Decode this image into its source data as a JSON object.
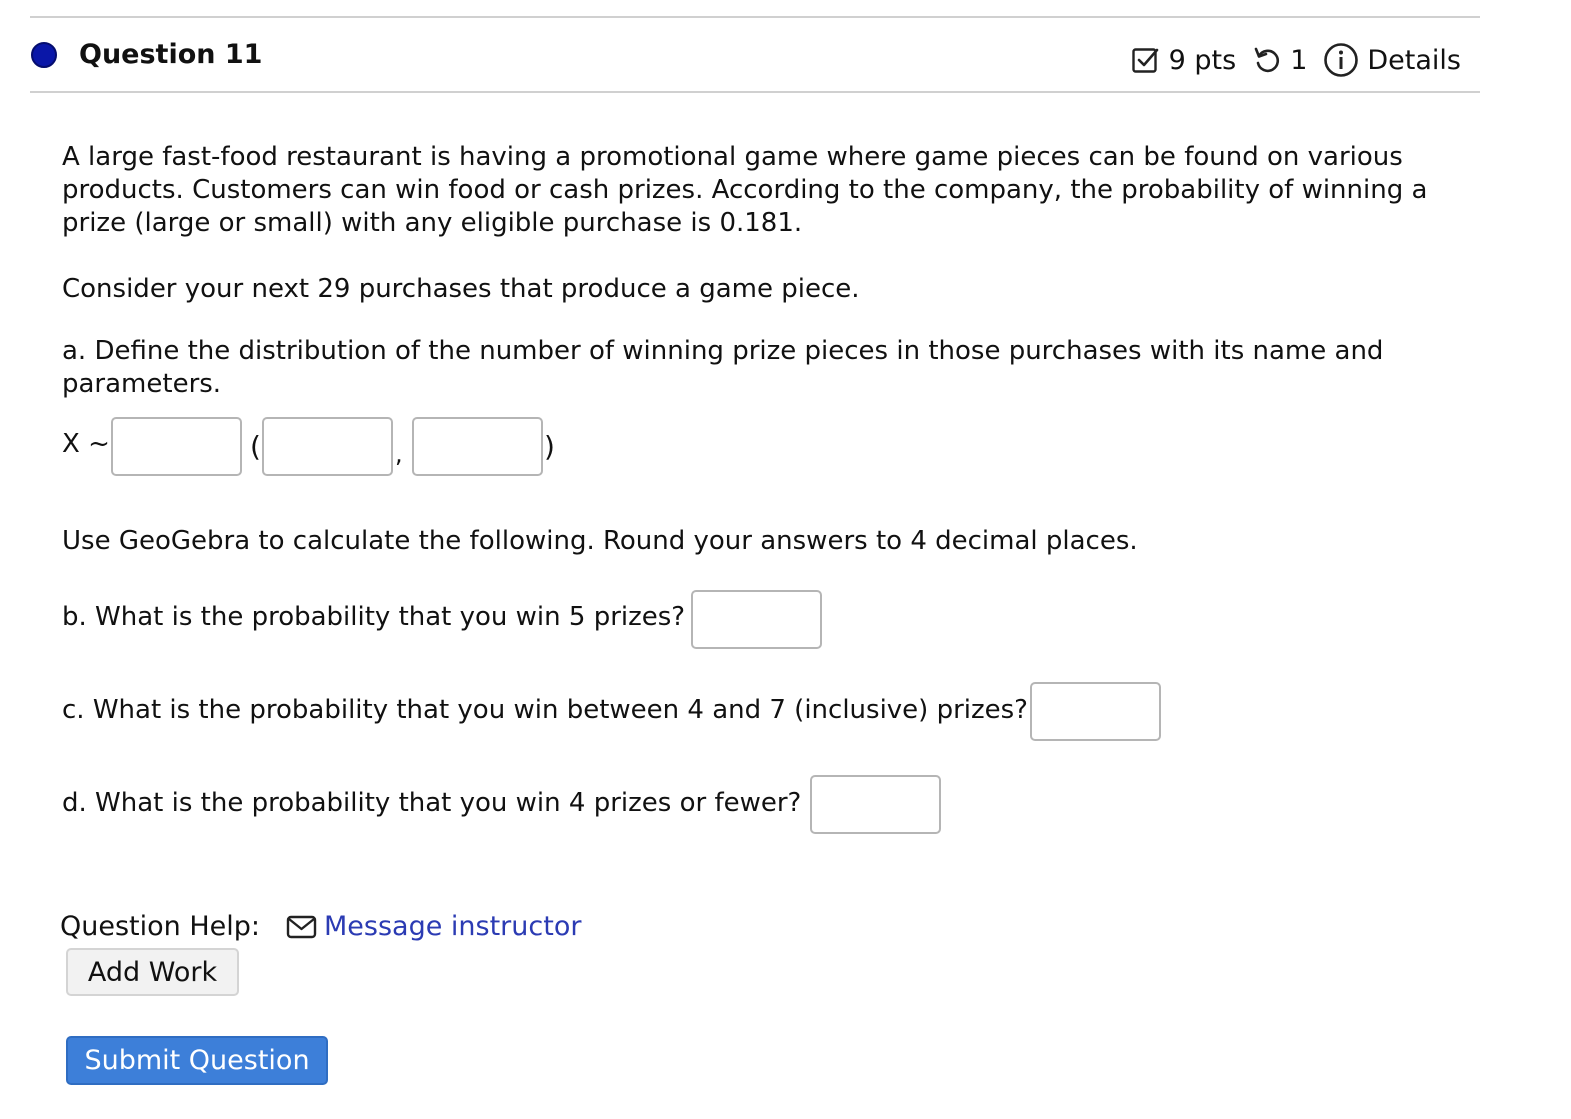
{
  "header": {
    "title": "Question 11",
    "points": "9 pts",
    "attempts": "1",
    "details": "Details"
  },
  "body": {
    "intro": "A large fast-food restaurant is having a promotional game where game pieces can be found on various products. Customers can win food or cash prizes. According to the company, the probability of winning a prize (large or small) with any eligible purchase is 0.181.",
    "consider": "Consider your next 29 purchases that produce a game piece.",
    "part_a": "a. Define the distribution of the number of winning prize pieces in those purchases with its name and parameters.",
    "x_label": "X ~",
    "open_paren": "(",
    "comma": ",",
    "close_paren": ")",
    "geogebra": "Use GeoGebra to calculate the following. Round your answers to 4 decimal places.",
    "part_b": "b. What is the probability that you win 5 prizes?",
    "part_c": "c. What is the probability that you win between 4 and 7 (inclusive) prizes?",
    "part_d": "d. What is the probability that you win 4 prizes or fewer?"
  },
  "answers": {
    "dist_name": "",
    "param1": "",
    "param2": "",
    "b": "",
    "c": "",
    "d": ""
  },
  "help": {
    "label": "Question Help:",
    "message_link": "Message instructor",
    "add_work": "Add Work"
  },
  "submit": {
    "label": "Submit Question"
  },
  "icons": {
    "status": "circle-filled-icon",
    "points": "checkbox-icon",
    "attempts": "retry-icon",
    "details": "info-icon",
    "message": "envelope-icon"
  },
  "colors": {
    "status_dot": "#0a17a8",
    "link": "#2b3bb3",
    "submit_bg": "#3d7fd9"
  }
}
